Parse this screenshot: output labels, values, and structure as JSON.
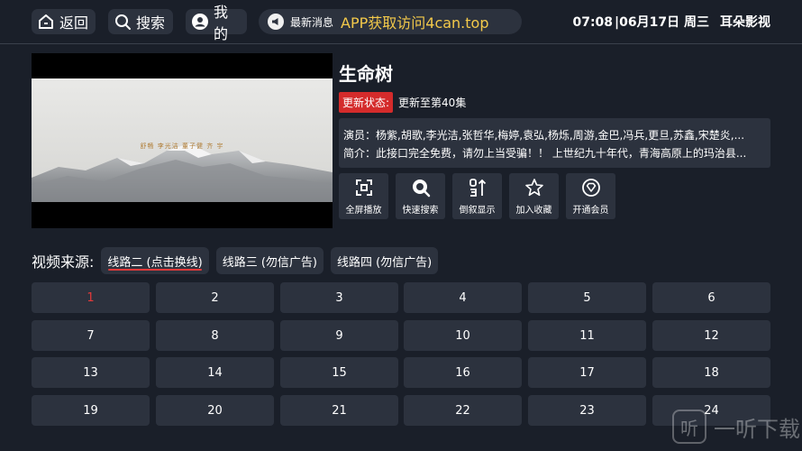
{
  "topbar": {
    "back_label": "返回",
    "search_label": "搜索",
    "mine_label": "我的",
    "notice_tag": "最新消息",
    "notice_text": "APP获取访问4can.top",
    "time": "07:08",
    "date": "|06月17日 周三",
    "app_name": "耳朵影视",
    "notice_color": "#f3c94a"
  },
  "player": {
    "credits": "舒畅   李光洁   董子健   齐 宇"
  },
  "info": {
    "title": "生命树",
    "status_tag": "更新状态:",
    "status_value": "更新至第40集",
    "actors": "演员：杨紫,胡歌,李光洁,张哲华,梅婷,袁弘,杨烁,周游,金巴,冯兵,更旦,苏鑫,宋楚炎,...",
    "intro": "简介：此接口完全免费，请勿上当受骗！！ 上世纪九十年代，青海高原上的玛治县..."
  },
  "actions": [
    {
      "label": "全屏播放",
      "icon": "fullscreen-icon"
    },
    {
      "label": "快速搜索",
      "icon": "search-icon"
    },
    {
      "label": "倒叙显示",
      "icon": "sort-icon"
    },
    {
      "label": "加入收藏",
      "icon": "star-icon"
    },
    {
      "label": "开通会员",
      "icon": "vip-diamond-icon"
    }
  ],
  "source": {
    "label": "视频来源:",
    "options": [
      "线路二 (点击换线)",
      "线路三 (勿信广告)",
      "线路四 (勿信广告)"
    ],
    "active_index": 0,
    "accent": "#e23a3a"
  },
  "episodes": [
    "1",
    "2",
    "3",
    "4",
    "5",
    "6",
    "7",
    "8",
    "9",
    "10",
    "11",
    "12",
    "13",
    "14",
    "15",
    "16",
    "17",
    "18",
    "19",
    "20",
    "21",
    "22",
    "23",
    "24"
  ],
  "current_episode": "1",
  "watermark": {
    "logo": "听",
    "text": "一听下载"
  }
}
